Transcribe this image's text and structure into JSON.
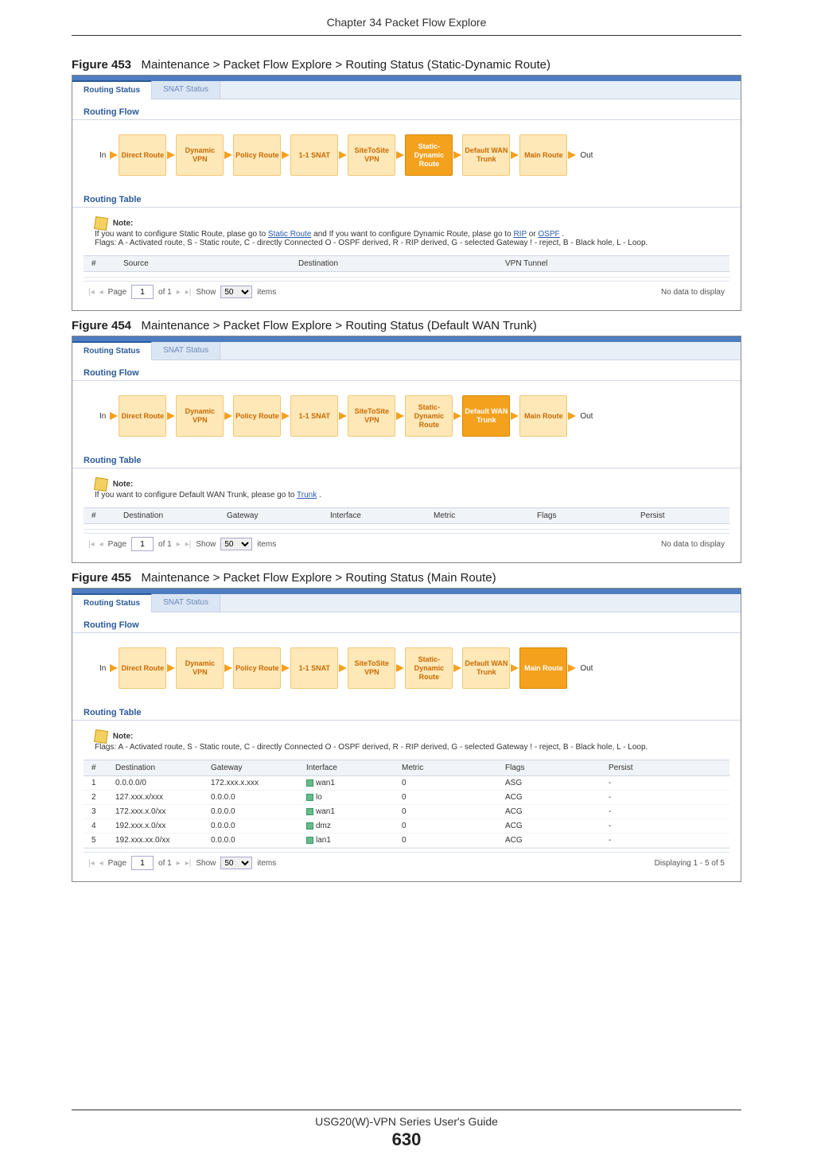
{
  "chapter_header": "Chapter 34 Packet Flow Explore",
  "footer_title": "USG20(W)-VPN Series User's Guide",
  "footer_page": "630",
  "tabs": {
    "routing_status": "Routing Status",
    "snat_status": "SNAT Status"
  },
  "sections": {
    "routing_flow": "Routing Flow",
    "routing_table": "Routing Table"
  },
  "io": {
    "in": "In",
    "out": "Out"
  },
  "flow_labels": {
    "direct": "Direct Route",
    "dynvpn": "Dynamic VPN",
    "policy": "Policy Route",
    "snat": "1-1 SNAT",
    "s2s": "SiteToSite VPN",
    "staticdyn": "Static-Dynamic Route",
    "wantrunk": "Default WAN Trunk",
    "main": "Main Route"
  },
  "pager": {
    "page_label": "Page",
    "of_label": "of 1",
    "show_label": "Show",
    "items_label": "items",
    "page_value": "1",
    "show_value": "50",
    "no_data": "No data to display",
    "displaying": "Displaying 1 - 5 of 5"
  },
  "fig453": {
    "caption_num": "Figure 453",
    "caption_text": "Maintenance > Packet Flow Explore > Routing Status (Static-Dynamic Route)",
    "note_label": "Note:",
    "note_line1_pre": "If you want to configure Static Route, plase go to ",
    "note_link1": "Static Route",
    "note_line1_mid": " and If you want to configure Dynamic Route, plase go to ",
    "note_link2": "RIP",
    "note_or": " or ",
    "note_link3": "OSPF",
    "note_line1_post": ".",
    "note_flags": "Flags: A - Activated route, S - Static route, C - directly Connected O - OSPF derived, R - RIP derived, G - selected Gateway ! - reject, B - Black hole, L - Loop.",
    "columns": {
      "num": "#",
      "source": "Source",
      "destination": "Destination",
      "vpn": "VPN Tunnel"
    }
  },
  "fig454": {
    "caption_num": "Figure 454",
    "caption_text": "Maintenance > Packet Flow Explore > Routing Status (Default WAN Trunk)",
    "note_label": "Note:",
    "note_line_pre": "If you want to configure Default WAN Trunk, please go to ",
    "note_link": "Trunk",
    "note_line_post": ".",
    "columns": {
      "num": "#",
      "destination": "Destination",
      "gateway": "Gateway",
      "interface": "Interface",
      "metric": "Metric",
      "flags": "Flags",
      "persist": "Persist"
    }
  },
  "fig455": {
    "caption_num": "Figure 455",
    "caption_text": "Maintenance > Packet Flow Explore > Routing Status (Main Route)",
    "note_label": "Note:",
    "note_flags": "Flags: A - Activated route, S - Static route, C - directly Connected O - OSPF derived, R - RIP derived, G - selected Gateway ! - reject, B - Black hole, L - Loop.",
    "columns": {
      "num": "#",
      "destination": "Destination",
      "gateway": "Gateway",
      "interface": "Interface",
      "metric": "Metric",
      "flags": "Flags",
      "persist": "Persist"
    },
    "rows": [
      {
        "n": "1",
        "dest": "0.0.0.0/0",
        "gw": "172.xxx.x.xxx",
        "iface": "wan1",
        "metric": "0",
        "flags": "ASG",
        "persist": "-"
      },
      {
        "n": "2",
        "dest": "127.xxx.x/xxx",
        "gw": "0.0.0.0",
        "iface": "lo",
        "metric": "0",
        "flags": "ACG",
        "persist": "-"
      },
      {
        "n": "3",
        "dest": "172.xxx.x.0/xx",
        "gw": "0.0.0.0",
        "iface": "wan1",
        "metric": "0",
        "flags": "ACG",
        "persist": "-"
      },
      {
        "n": "4",
        "dest": "192.xxx.x.0/xx",
        "gw": "0.0.0.0",
        "iface": "dmz",
        "metric": "0",
        "flags": "ACG",
        "persist": "-"
      },
      {
        "n": "5",
        "dest": "192.xxx.xx.0/xx",
        "gw": "0.0.0.0",
        "iface": "lan1",
        "metric": "0",
        "flags": "ACG",
        "persist": "-"
      }
    ]
  }
}
